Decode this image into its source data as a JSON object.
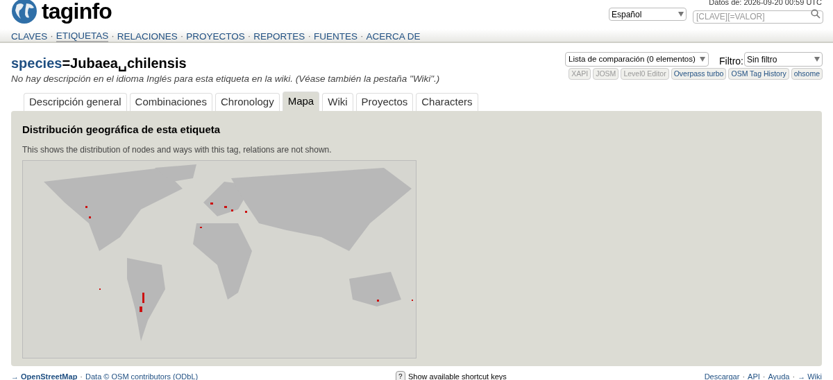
{
  "logo": {
    "text": "taginfo"
  },
  "data_date": "Datos de: 2026-09-20 00:59 UTC",
  "separator": "·",
  "language_select": {
    "value": "Español"
  },
  "search": {
    "placeholder": "[CLAVE][=VALOR]"
  },
  "nav": [
    {
      "label": "CLAVES",
      "selected": false
    },
    {
      "label": "ETIQUETAS",
      "selected": true
    },
    {
      "label": "RELACIONES",
      "selected": false
    },
    {
      "label": "PROYECTOS",
      "selected": false
    },
    {
      "label": "REPORTES",
      "selected": false
    },
    {
      "label": "FUENTES",
      "selected": false
    },
    {
      "label": "ACERCA DE",
      "selected": false
    }
  ],
  "title": {
    "key": "species",
    "value": "=Jubaea␣chilensis"
  },
  "description": "No hay descripción en el idioma Inglés para esta etiqueta en la wiki. (Véase también la pestaña \"Wiki\".)",
  "comparison_select": {
    "value": "Lista de comparación (0 elementos)"
  },
  "filter": {
    "label": "Filtro:",
    "value": "Sin filtro"
  },
  "tools": [
    {
      "label": "XAPI",
      "disabled": true
    },
    {
      "label": "JOSM",
      "disabled": true
    },
    {
      "label": "Level0 Editor",
      "disabled": true
    },
    {
      "label": "Overpass turbo",
      "disabled": false
    },
    {
      "label": "OSM Tag History",
      "disabled": false
    },
    {
      "label": "ohsome",
      "disabled": false
    }
  ],
  "tabs": [
    {
      "label": "Descripción general",
      "selected": false
    },
    {
      "label": "Combinaciones",
      "selected": false
    },
    {
      "label": "Chronology",
      "selected": false
    },
    {
      "label": "Mapa",
      "selected": true
    },
    {
      "label": "Wiki",
      "selected": false
    },
    {
      "label": "Proyectos",
      "selected": false
    },
    {
      "label": "Characters",
      "selected": false
    }
  ],
  "panel": {
    "heading": "Distribución geográfica de esta etiqueta",
    "text": "This shows the distribution of nodes and ways with this tag, relations are not shown."
  },
  "footer": {
    "left": [
      {
        "label": "→ OpenStreetMap",
        "bold": true
      },
      {
        "label": "Data © OSM contributors (ODbL)",
        "bold": false
      }
    ],
    "key": "?",
    "shortcut": "Show available shortcut keys",
    "right": [
      "Descargar",
      "API",
      "Ayuda",
      "→ Wiki"
    ]
  }
}
